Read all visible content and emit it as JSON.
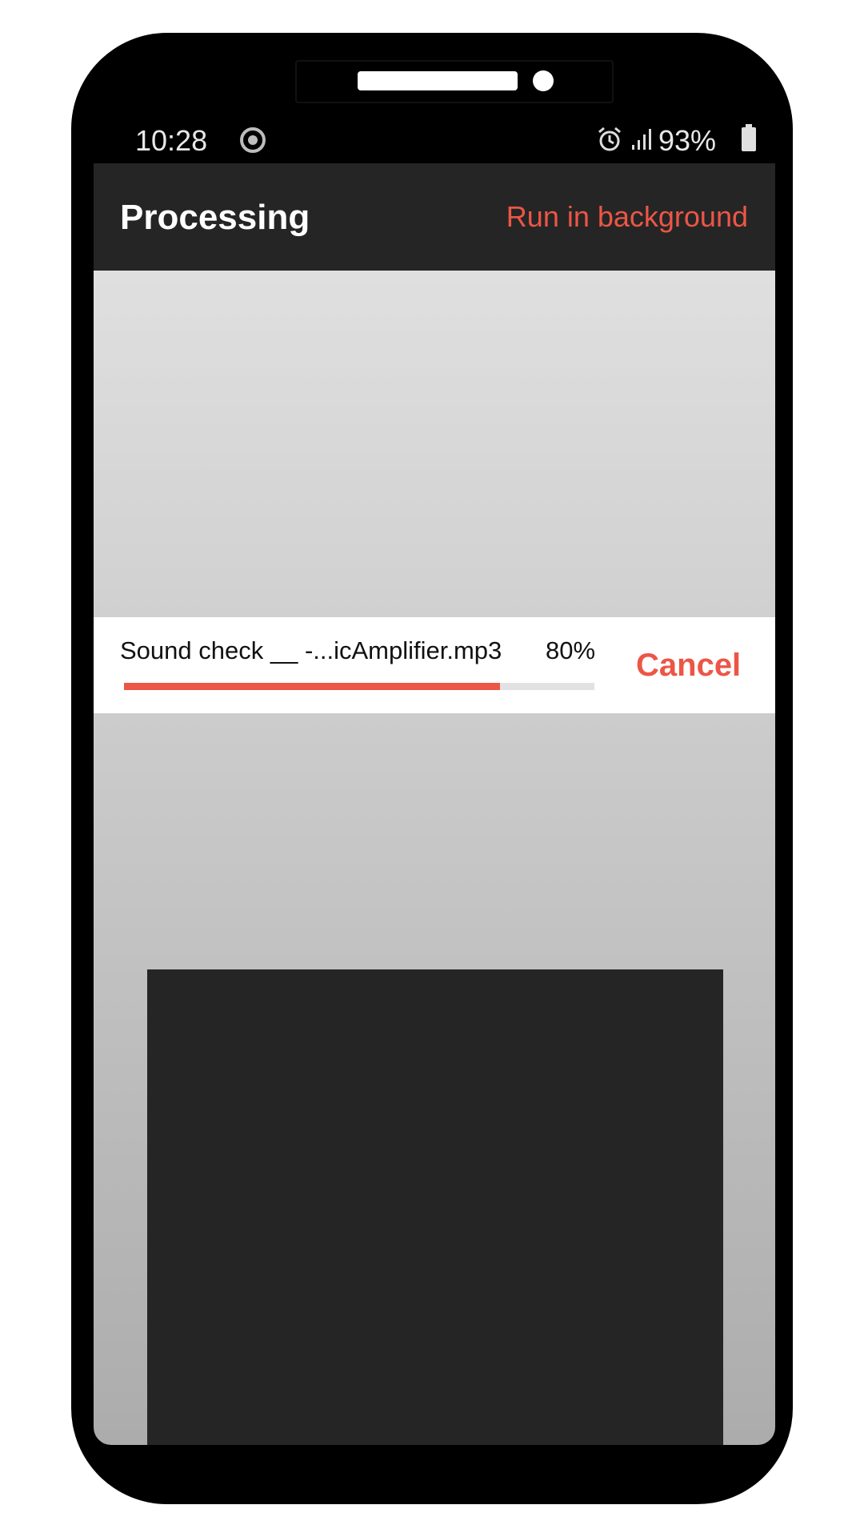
{
  "status_bar": {
    "time": "10:28",
    "battery": "93%",
    "icons": [
      "record-icon",
      "alarm-icon",
      "signal-icon",
      "battery-icon"
    ]
  },
  "app_bar": {
    "title": "Processing",
    "action_label": "Run in background"
  },
  "progress": {
    "file_name": "Sound check __ -...icAmplifier.mp3",
    "percent_label": "80%",
    "fraction": 0.8,
    "cancel_label": "Cancel"
  },
  "colors": {
    "accent": "#ec5646",
    "app_bar": "#252525",
    "panel": "#252525"
  }
}
